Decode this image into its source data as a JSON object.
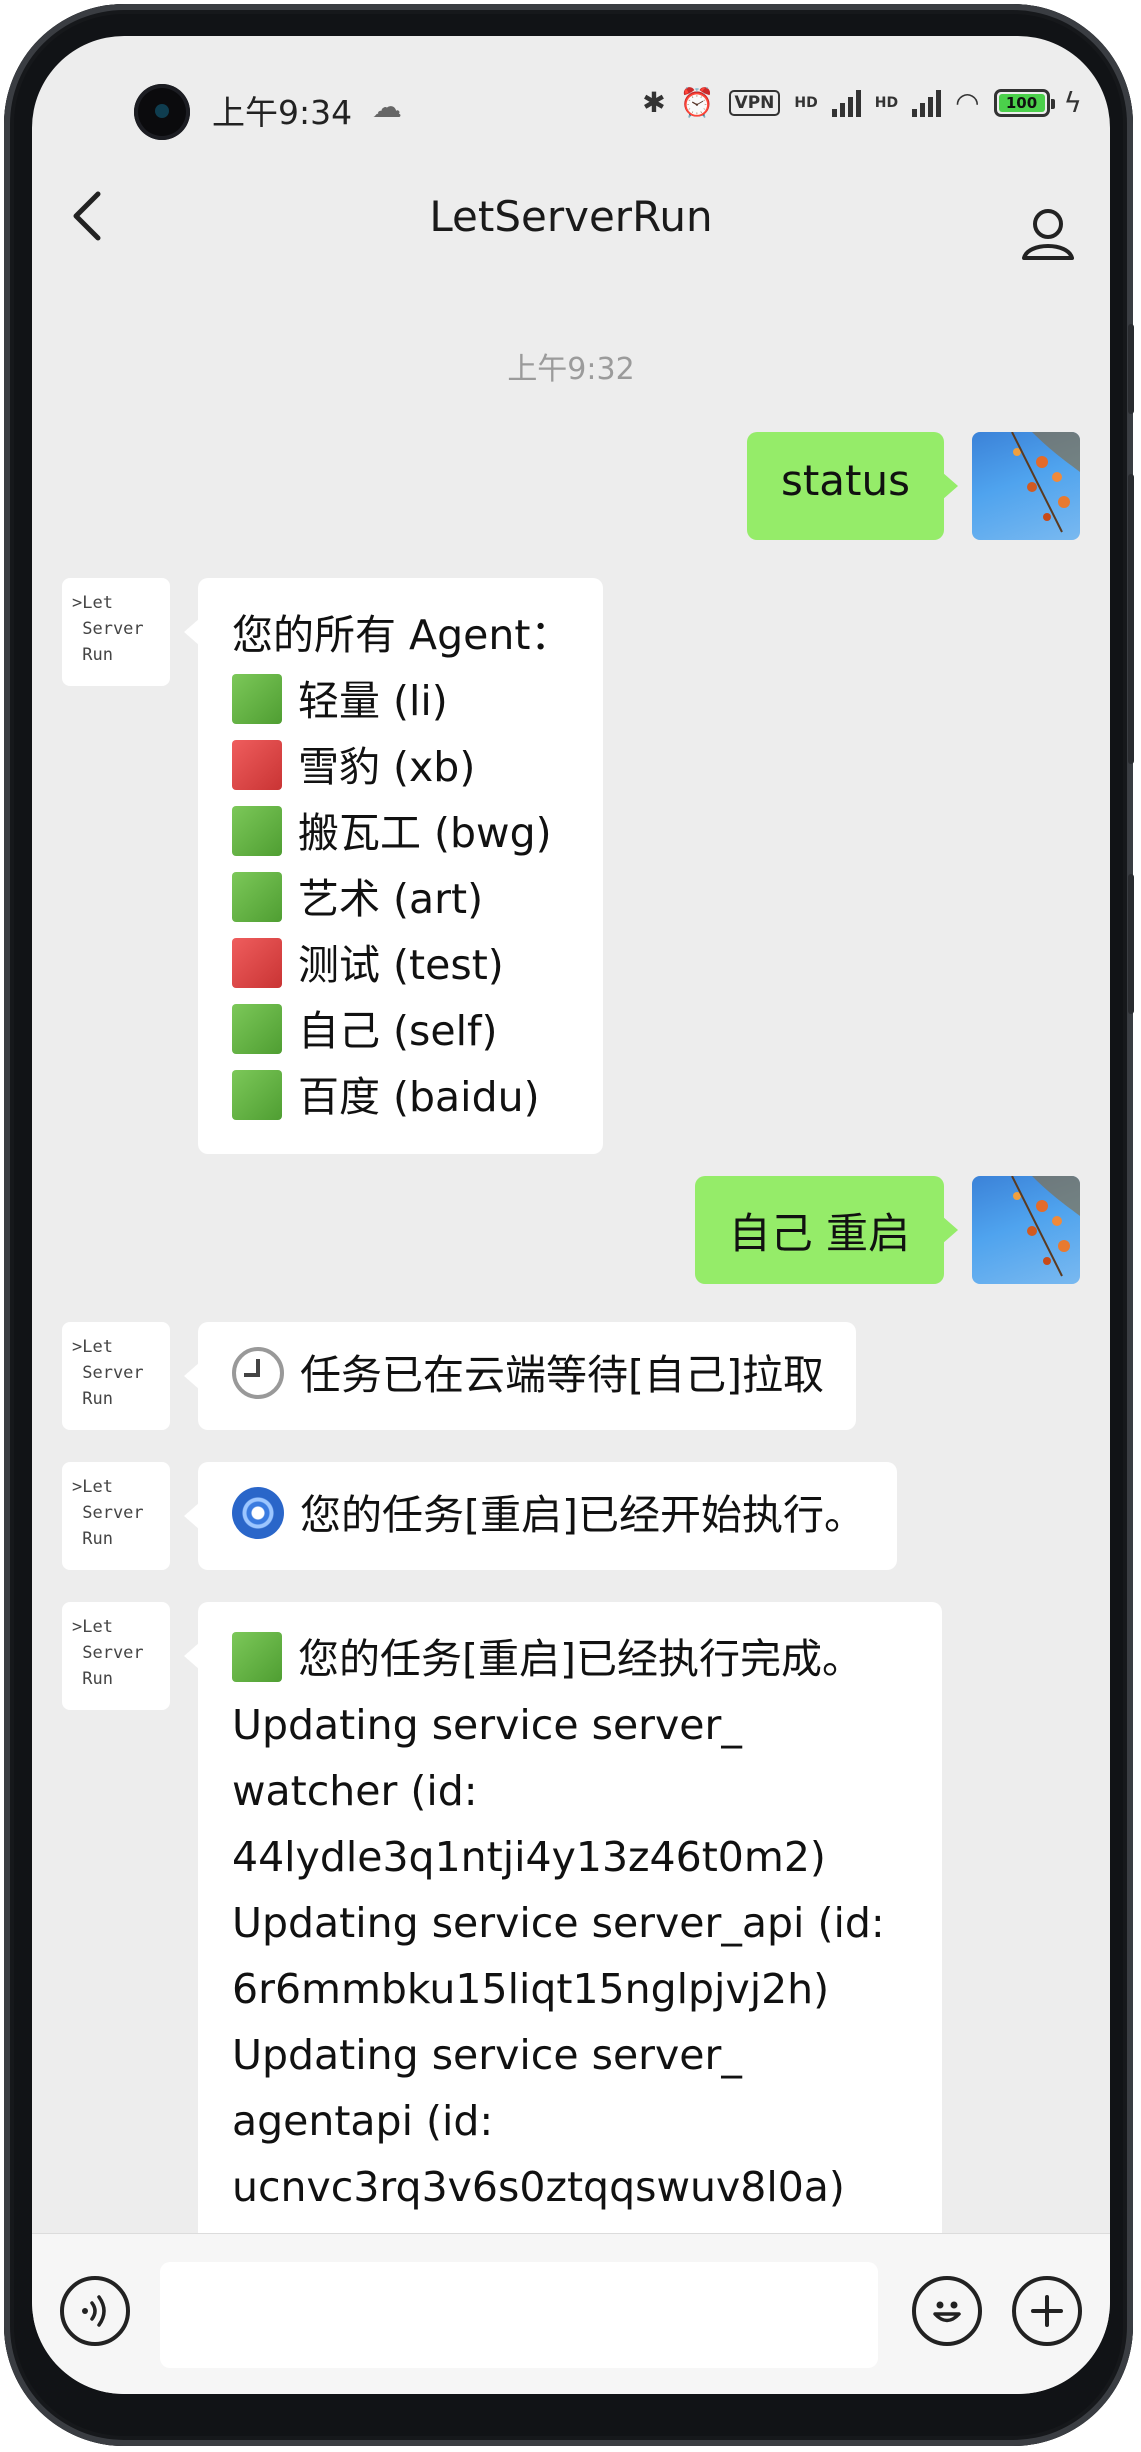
{
  "statusbar": {
    "time": "上午9:34",
    "vpn_label": "VPN",
    "hd_label": "HD",
    "battery_level": "100"
  },
  "header": {
    "title": "LetServerRun"
  },
  "chat": {
    "timestamp": "上午9:32",
    "bot_avatar_text": ">Let\n Server\n Run",
    "messages": [
      {
        "from": "me",
        "text": "status"
      },
      {
        "from": "bot",
        "title": "您的所有 Agent：",
        "agents": [
          {
            "status": "green",
            "label": "轻量 (li)"
          },
          {
            "status": "red",
            "label": "雪豹 (xb)"
          },
          {
            "status": "green",
            "label": "搬瓦工 (bwg)"
          },
          {
            "status": "green",
            "label": "艺术 (art)"
          },
          {
            "status": "red",
            "label": "测试 (test)"
          },
          {
            "status": "green",
            "label": "自己 (self)"
          },
          {
            "status": "green",
            "label": "百度 (baidu)"
          }
        ]
      },
      {
        "from": "me",
        "text": "自己 重启"
      },
      {
        "from": "bot",
        "icon": "clock-icon",
        "text": "任务已在云端等待[自己]拉取"
      },
      {
        "from": "bot",
        "icon": "cyclone-icon",
        "text": "您的任务[重启]已经开始执行。"
      },
      {
        "from": "bot",
        "icon": "green-square-icon",
        "first_line": "您的任务[重启]已经执行完成。",
        "lines": [
          "Updating service server_",
          "watcher (id:",
          "44lydle3q1ntji4y13z46t0m2)",
          "Updating service server_api (id:",
          "6r6mmbku15liqt15nglpjvj2h)",
          "Updating service server_",
          "agentapi (id:",
          "ucnvc3rq3v6s0ztqqswuv8l0a)"
        ]
      }
    ]
  },
  "colors": {
    "my_bubble": "#95ec69",
    "status_green": "#67b944",
    "status_red": "#e04848",
    "background": "#ededed"
  }
}
